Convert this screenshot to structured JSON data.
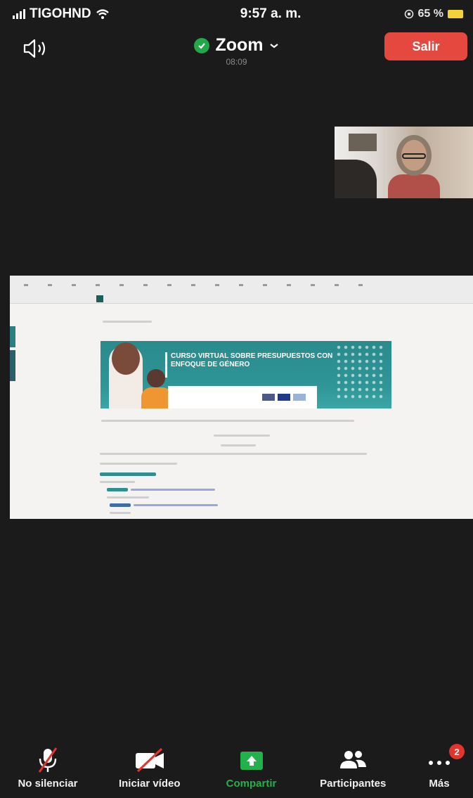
{
  "status_bar": {
    "carrier": "TIGOHND",
    "time": "9:57 a. m.",
    "battery_text": "65 %",
    "signal_icon": "signal-bars-icon",
    "wifi_icon": "wifi-icon"
  },
  "header": {
    "speaker_icon": "speaker-icon",
    "title": "Zoom",
    "timer": "08:09",
    "leave_label": "Salir",
    "colors": {
      "leave": "#e5483f",
      "shield": "#22a84a"
    }
  },
  "shared_screen": {
    "banner_headline": "CURSO VIRTUAL SOBRE PRESUPUESTOS CON ENFOQUE DE GÉNERO"
  },
  "toolbar": {
    "items": [
      {
        "label": "No silenciar",
        "icon": "microphone-muted-icon"
      },
      {
        "label": "Iniciar vídeo",
        "icon": "video-off-icon"
      },
      {
        "label": "Compartir",
        "icon": "share-screen-icon"
      },
      {
        "label": "Participantes",
        "icon": "participants-icon"
      },
      {
        "label": "Más",
        "icon": "more-icon",
        "badge": "2"
      }
    ],
    "colors": {
      "share": "#22b14c",
      "badge": "#e3352b"
    }
  }
}
